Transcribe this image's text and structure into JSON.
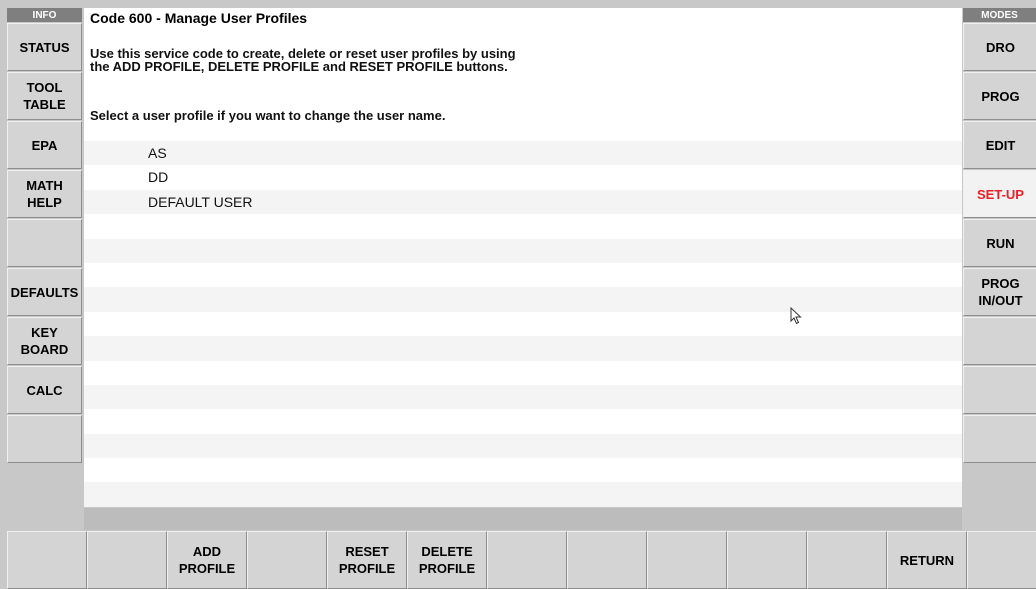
{
  "header": {
    "info_label": "INFO",
    "modes_label": "MODES"
  },
  "main": {
    "title": "Code 600 - Manage User Profiles",
    "description": "Use this service code to create, delete or reset user profiles by using\nthe ADD PROFILE, DELETE PROFILE and RESET PROFILE buttons.",
    "prompt": "Select a user profile if you want to change the user name.",
    "profiles": [
      "AS",
      "DD",
      "DEFAULT USER"
    ],
    "total_rows": 15
  },
  "left_buttons": [
    "STATUS",
    "TOOL\nTABLE",
    "EPA",
    "MATH\nHELP",
    "",
    "DEFAULTS",
    "KEY\nBOARD",
    "CALC",
    ""
  ],
  "right_buttons": [
    "DRO",
    "PROG",
    "EDIT",
    "SET-UP",
    "RUN",
    "PROG\nIN/OUT",
    "",
    "",
    ""
  ],
  "active_mode": "SET-UP",
  "bottom_buttons": [
    "",
    "",
    "ADD\nPROFILE",
    "",
    "RESET\nPROFILE",
    "DELETE\nPROFILE",
    "",
    "",
    "",
    "",
    "",
    "RETURN",
    ""
  ],
  "colors": {
    "active_text": "#e8202a",
    "header_bg": "#7f7f7f",
    "button_bg": "#d4d4d4"
  }
}
